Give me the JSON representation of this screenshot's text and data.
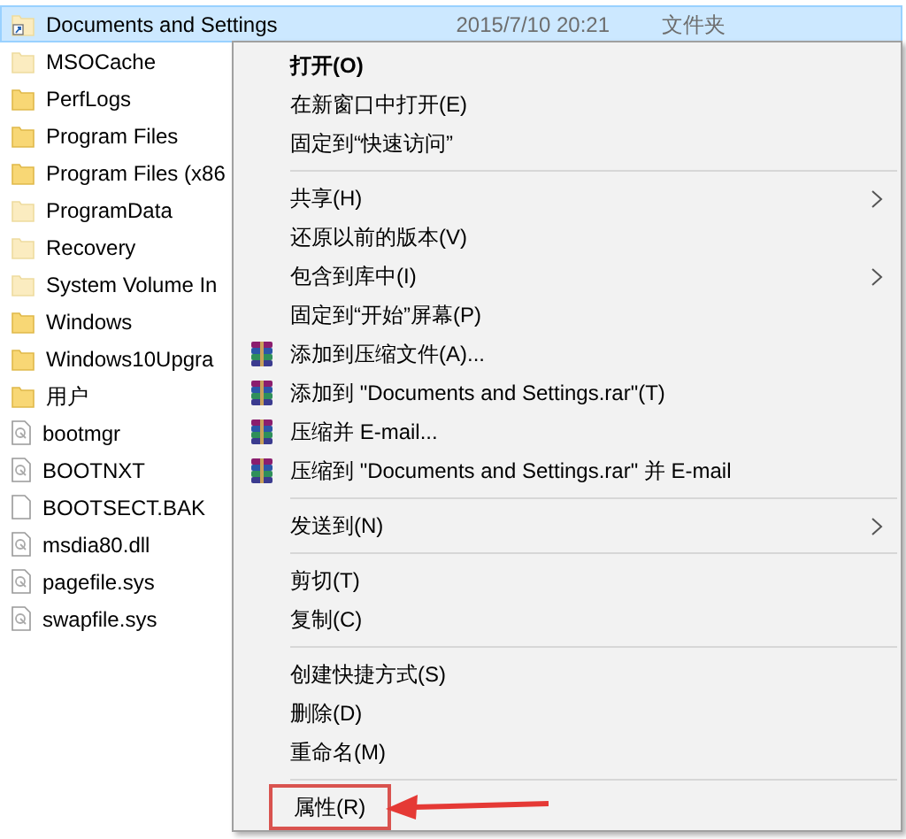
{
  "files": [
    {
      "name": "Documents and Settings",
      "date": "2015/7/10 20:21",
      "type": "文件夹",
      "kind": "shortcut",
      "selected": true
    },
    {
      "name": "MSOCache",
      "kind": "hidden",
      "selected": false
    },
    {
      "name": "PerfLogs",
      "kind": "folder",
      "selected": false
    },
    {
      "name": "Program Files",
      "kind": "folder",
      "selected": false
    },
    {
      "name": "Program Files (x86",
      "kind": "folder",
      "selected": false
    },
    {
      "name": "ProgramData",
      "kind": "hidden",
      "selected": false
    },
    {
      "name": "Recovery",
      "kind": "hidden",
      "selected": false
    },
    {
      "name": "System Volume In",
      "kind": "hidden",
      "selected": false
    },
    {
      "name": "Windows",
      "kind": "folder",
      "selected": false
    },
    {
      "name": "Windows10Upgra",
      "kind": "folder",
      "selected": false
    },
    {
      "name": "用户",
      "kind": "folder",
      "selected": false
    },
    {
      "name": "bootmgr",
      "kind": "system",
      "selected": false
    },
    {
      "name": "BOOTNXT",
      "kind": "system",
      "selected": false
    },
    {
      "name": "BOOTSECT.BAK",
      "kind": "file",
      "selected": false
    },
    {
      "name": "msdia80.dll",
      "kind": "system",
      "selected": false
    },
    {
      "name": "pagefile.sys",
      "kind": "system",
      "selected": false
    },
    {
      "name": "swapfile.sys",
      "kind": "system",
      "selected": false
    }
  ],
  "context_menu": [
    {
      "kind": "item",
      "label": "打开(O)",
      "bold": true,
      "submenu": false,
      "highlighted": false
    },
    {
      "kind": "item",
      "label": "在新窗口中打开(E)",
      "bold": false,
      "submenu": false,
      "highlighted": false
    },
    {
      "kind": "item",
      "label": "固定到“快速访问”",
      "bold": false,
      "submenu": false,
      "highlighted": false
    },
    {
      "kind": "separator"
    },
    {
      "kind": "item",
      "label": "共享(H)",
      "bold": false,
      "submenu": true,
      "highlighted": false
    },
    {
      "kind": "item",
      "label": "还原以前的版本(V)",
      "bold": false,
      "submenu": false,
      "highlighted": false
    },
    {
      "kind": "item",
      "label": "包含到库中(I)",
      "bold": false,
      "submenu": true,
      "highlighted": false
    },
    {
      "kind": "item",
      "label": "固定到“开始”屏幕(P)",
      "bold": false,
      "submenu": false,
      "highlighted": false
    },
    {
      "kind": "archive",
      "label": "添加到压缩文件(A)...",
      "bold": false,
      "submenu": false,
      "highlighted": false
    },
    {
      "kind": "archive",
      "label": "添加到 \"Documents and Settings.rar\"(T)",
      "bold": false,
      "submenu": false,
      "highlighted": false
    },
    {
      "kind": "archive",
      "label": "压缩并 E-mail...",
      "bold": false,
      "submenu": false,
      "highlighted": false
    },
    {
      "kind": "archive",
      "label": "压缩到 \"Documents and Settings.rar\" 并 E-mail",
      "bold": false,
      "submenu": false,
      "highlighted": false
    },
    {
      "kind": "separator"
    },
    {
      "kind": "item",
      "label": "发送到(N)",
      "bold": false,
      "submenu": true,
      "highlighted": false
    },
    {
      "kind": "separator"
    },
    {
      "kind": "item",
      "label": "剪切(T)",
      "bold": false,
      "submenu": false,
      "highlighted": false
    },
    {
      "kind": "item",
      "label": "复制(C)",
      "bold": false,
      "submenu": false,
      "highlighted": false
    },
    {
      "kind": "separator"
    },
    {
      "kind": "item",
      "label": "创建快捷方式(S)",
      "bold": false,
      "submenu": false,
      "highlighted": false
    },
    {
      "kind": "item",
      "label": "删除(D)",
      "bold": false,
      "submenu": false,
      "highlighted": false
    },
    {
      "kind": "item",
      "label": "重命名(M)",
      "bold": false,
      "submenu": false,
      "highlighted": false
    },
    {
      "kind": "separator"
    },
    {
      "kind": "item",
      "label": "属性(R)",
      "bold": false,
      "submenu": false,
      "highlighted": true
    }
  ]
}
